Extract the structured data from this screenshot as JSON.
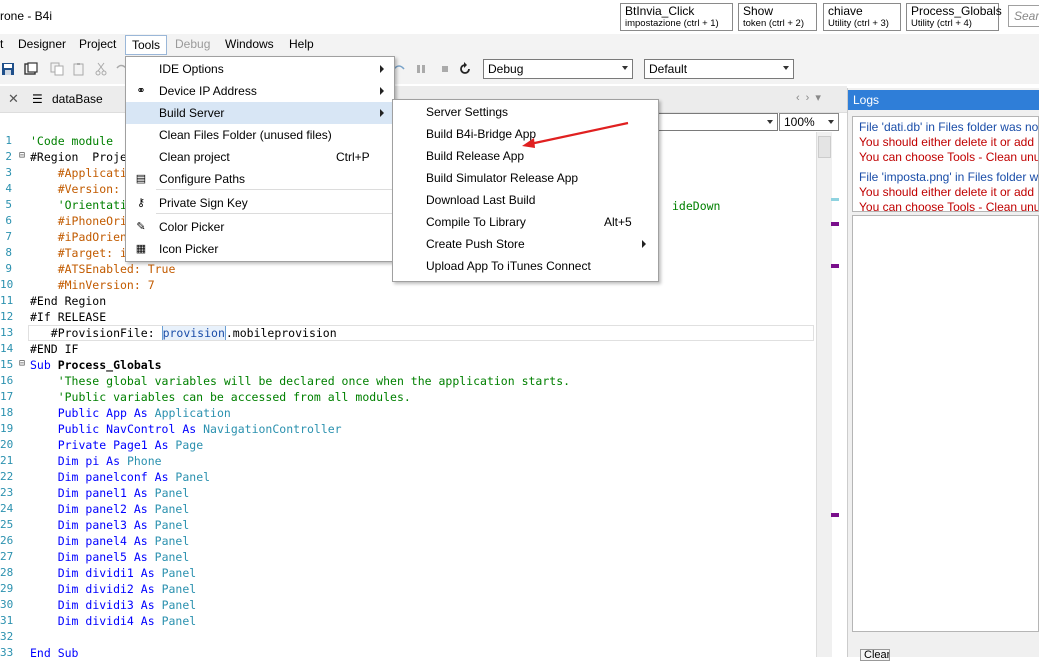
{
  "window": {
    "title": "rone - B4i"
  },
  "quick_buttons": [
    {
      "title": "BtInvia_Click",
      "subtitle": "impostazione  (ctrl + 1)"
    },
    {
      "title": "Show",
      "subtitle": "token  (ctrl + 2)"
    },
    {
      "title": "chiave",
      "subtitle": "Utility  (ctrl + 3)"
    },
    {
      "title": "Process_Globals",
      "subtitle": "Utility  (ctrl + 4)"
    }
  ],
  "search": {
    "placeholder": "Search"
  },
  "menubar": {
    "partial": "t",
    "designer": "Designer",
    "project": "Project",
    "tools": "Tools",
    "debug": "Debug",
    "windows": "Windows",
    "help": "Help"
  },
  "toolbar": {
    "build_config": "Debug",
    "device": "Default"
  },
  "tabs": {
    "active": "dataBase"
  },
  "editor": {
    "zoom": "100%"
  },
  "code_lines": [
    {
      "n": "1",
      "fold": "",
      "parts": [
        {
          "t": "'Code module",
          "c": "c-comment"
        }
      ]
    },
    {
      "n": "2",
      "fold": "⊟",
      "parts": [
        {
          "t": "#Region  Proje",
          "c": "c-plain"
        }
      ]
    },
    {
      "n": "3",
      "fold": "",
      "parts": [
        {
          "t": "    #Applicati",
          "c": "c-dir"
        }
      ]
    },
    {
      "n": "4",
      "fold": "",
      "parts": [
        {
          "t": "    #Version: ",
          "c": "c-dir"
        }
      ]
    },
    {
      "n": "5",
      "fold": "",
      "parts": [
        {
          "t": "    'Orientati",
          "c": "c-comment"
        }
      ]
    },
    {
      "n": "6",
      "fold": "",
      "parts": [
        {
          "t": "    #iPhoneOri",
          "c": "c-dir"
        }
      ]
    },
    {
      "n": "7",
      "fold": "",
      "parts": [
        {
          "t": "    #iPadOrien",
          "c": "c-dir"
        }
      ]
    },
    {
      "n": "8",
      "fold": "",
      "parts": [
        {
          "t": "    #Target: i",
          "c": "c-dir"
        }
      ]
    },
    {
      "n": "9",
      "fold": "",
      "parts": [
        {
          "t": "    #ATSEnabled: ",
          "c": "c-dir"
        },
        {
          "t": "True",
          "c": "c-dir"
        }
      ]
    },
    {
      "n": "10",
      "fold": "",
      "parts": [
        {
          "t": "    #MinVersion: 7",
          "c": "c-dir"
        }
      ]
    },
    {
      "n": "11",
      "fold": "",
      "parts": [
        {
          "t": "#End Region",
          "c": "c-plain"
        }
      ]
    },
    {
      "n": "12",
      "fold": "",
      "parts": [
        {
          "t": "#If RELEASE",
          "c": "c-plain"
        }
      ]
    },
    {
      "n": "13",
      "fold": "",
      "parts": [
        {
          "t": "   #ProvisionFile: ",
          "c": "c-plain"
        },
        {
          "t": "provision",
          "c": "c-plain"
        },
        {
          "t": ".mobileprovision",
          "c": "c-plain"
        }
      ]
    },
    {
      "n": "14",
      "fold": "",
      "parts": [
        {
          "t": "#END IF",
          "c": "c-plain"
        }
      ]
    },
    {
      "n": "15",
      "fold": "⊟",
      "parts": [
        {
          "t": "Sub ",
          "c": "c-kw"
        },
        {
          "t": "Process_Globals",
          "c": "c-bold"
        }
      ]
    },
    {
      "n": "16",
      "fold": "",
      "parts": [
        {
          "t": "    'These global variables will be declared once when the application starts.",
          "c": "c-comment"
        }
      ]
    },
    {
      "n": "17",
      "fold": "",
      "parts": [
        {
          "t": "    'Public variables can be accessed from all modules.",
          "c": "c-comment"
        }
      ]
    },
    {
      "n": "18",
      "fold": "",
      "parts": [
        {
          "t": "    Public ",
          "c": "c-kw"
        },
        {
          "t": "App ",
          "c": "c-kw"
        },
        {
          "t": "As ",
          "c": "c-kw"
        },
        {
          "t": "Application",
          "c": "c-type"
        }
      ]
    },
    {
      "n": "19",
      "fold": "",
      "parts": [
        {
          "t": "    Public ",
          "c": "c-kw"
        },
        {
          "t": "NavControl ",
          "c": "c-kw"
        },
        {
          "t": "As ",
          "c": "c-kw"
        },
        {
          "t": "NavigationController",
          "c": "c-type"
        }
      ]
    },
    {
      "n": "20",
      "fold": "",
      "parts": [
        {
          "t": "    Private ",
          "c": "c-kw"
        },
        {
          "t": "Page1 ",
          "c": "c-kw"
        },
        {
          "t": "As ",
          "c": "c-kw"
        },
        {
          "t": "Page",
          "c": "c-type"
        }
      ]
    },
    {
      "n": "21",
      "fold": "",
      "parts": [
        {
          "t": "    Dim ",
          "c": "c-kw"
        },
        {
          "t": "pi ",
          "c": "c-kw"
        },
        {
          "t": "As ",
          "c": "c-kw"
        },
        {
          "t": "Phone",
          "c": "c-type"
        }
      ]
    },
    {
      "n": "22",
      "fold": "",
      "parts": [
        {
          "t": "    Dim ",
          "c": "c-kw"
        },
        {
          "t": "panelconf ",
          "c": "c-kw"
        },
        {
          "t": "As ",
          "c": "c-kw"
        },
        {
          "t": "Panel",
          "c": "c-type"
        }
      ]
    },
    {
      "n": "23",
      "fold": "",
      "parts": [
        {
          "t": "    Dim ",
          "c": "c-kw"
        },
        {
          "t": "panel1 ",
          "c": "c-kw"
        },
        {
          "t": "As ",
          "c": "c-kw"
        },
        {
          "t": "Panel",
          "c": "c-type"
        }
      ]
    },
    {
      "n": "24",
      "fold": "",
      "parts": [
        {
          "t": "    Dim ",
          "c": "c-kw"
        },
        {
          "t": "panel2 ",
          "c": "c-kw"
        },
        {
          "t": "As ",
          "c": "c-kw"
        },
        {
          "t": "Panel",
          "c": "c-type"
        }
      ]
    },
    {
      "n": "25",
      "fold": "",
      "parts": [
        {
          "t": "    Dim ",
          "c": "c-kw"
        },
        {
          "t": "panel3 ",
          "c": "c-kw"
        },
        {
          "t": "As ",
          "c": "c-kw"
        },
        {
          "t": "Panel",
          "c": "c-type"
        }
      ]
    },
    {
      "n": "26",
      "fold": "",
      "parts": [
        {
          "t": "    Dim ",
          "c": "c-kw"
        },
        {
          "t": "panel4 ",
          "c": "c-kw"
        },
        {
          "t": "As ",
          "c": "c-kw"
        },
        {
          "t": "Panel",
          "c": "c-type"
        }
      ]
    },
    {
      "n": "27",
      "fold": "",
      "parts": [
        {
          "t": "    Dim ",
          "c": "c-kw"
        },
        {
          "t": "panel5 ",
          "c": "c-kw"
        },
        {
          "t": "As ",
          "c": "c-kw"
        },
        {
          "t": "Panel",
          "c": "c-type"
        }
      ]
    },
    {
      "n": "28",
      "fold": "",
      "parts": [
        {
          "t": "    Dim ",
          "c": "c-kw"
        },
        {
          "t": "dividi1 ",
          "c": "c-kw"
        },
        {
          "t": "As ",
          "c": "c-kw"
        },
        {
          "t": "Panel",
          "c": "c-type"
        }
      ]
    },
    {
      "n": "29",
      "fold": "",
      "parts": [
        {
          "t": "    Dim ",
          "c": "c-kw"
        },
        {
          "t": "dividi2 ",
          "c": "c-kw"
        },
        {
          "t": "As ",
          "c": "c-kw"
        },
        {
          "t": "Panel",
          "c": "c-type"
        }
      ]
    },
    {
      "n": "30",
      "fold": "",
      "parts": [
        {
          "t": "    Dim ",
          "c": "c-kw"
        },
        {
          "t": "dividi3 ",
          "c": "c-kw"
        },
        {
          "t": "As ",
          "c": "c-kw"
        },
        {
          "t": "Panel",
          "c": "c-type"
        }
      ]
    },
    {
      "n": "31",
      "fold": "",
      "parts": [
        {
          "t": "    Dim ",
          "c": "c-kw"
        },
        {
          "t": "dividi4 ",
          "c": "c-kw"
        },
        {
          "t": "As ",
          "c": "c-kw"
        },
        {
          "t": "Panel",
          "c": "c-type"
        }
      ]
    },
    {
      "n": "32",
      "fold": "",
      "parts": []
    },
    {
      "n": "33",
      "fold": "",
      "parts": [
        {
          "t": "End Sub",
          "c": "c-kw"
        }
      ]
    }
  ],
  "code_overflow": {
    "line5_tail": "ideDown"
  },
  "tools_menu": [
    {
      "label": "IDE Options",
      "icon": "",
      "submenu": true
    },
    {
      "label": "Device IP Address",
      "icon": "link-icon",
      "submenu": true
    },
    {
      "label": "Build Server",
      "icon": "",
      "submenu": true,
      "highlighted": true
    },
    {
      "label": "Clean Files Folder (unused files)",
      "icon": ""
    },
    {
      "label": "Clean project",
      "icon": "",
      "shortcut": "Ctrl+P"
    },
    {
      "label": "Configure Paths",
      "icon": "document-icon"
    },
    {
      "label": "Private Sign Key",
      "icon": "key-icon"
    },
    {
      "label": "Color Picker",
      "icon": "color-picker-icon"
    },
    {
      "label": "Icon Picker",
      "icon": "grid-icon"
    }
  ],
  "build_server_menu": [
    {
      "label": "Server Settings"
    },
    {
      "label": "Build B4i-Bridge App"
    },
    {
      "label": "Build Release App"
    },
    {
      "label": "Build Simulator Release App"
    },
    {
      "label": "Download Last Build"
    },
    {
      "label": "Compile To Library",
      "shortcut": "Alt+5"
    },
    {
      "label": "Create Push Store",
      "submenu": true
    },
    {
      "label": "Upload App To iTunes Connect"
    }
  ],
  "logs": {
    "title": "Logs",
    "lines": [
      {
        "text": "File 'dati.db' in Files folder was not",
        "color": "log-blue"
      },
      {
        "text": "You should either delete it or add i",
        "color": "log-red"
      },
      {
        "text": "You can choose Tools - Clean unu",
        "color": "log-red"
      },
      {
        "text": "File 'imposta.png' in Files folder wa",
        "color": "log-blue"
      },
      {
        "text": "You should either delete it or add i",
        "color": "log-red"
      },
      {
        "text": "You can choose Tools - Clean unu",
        "color": "log-red"
      }
    ],
    "clear_label": "Clear"
  },
  "colors": {
    "accent": "#2f7ed8",
    "arrow": "#e02020",
    "menu_highlight": "#d8e6f5"
  }
}
